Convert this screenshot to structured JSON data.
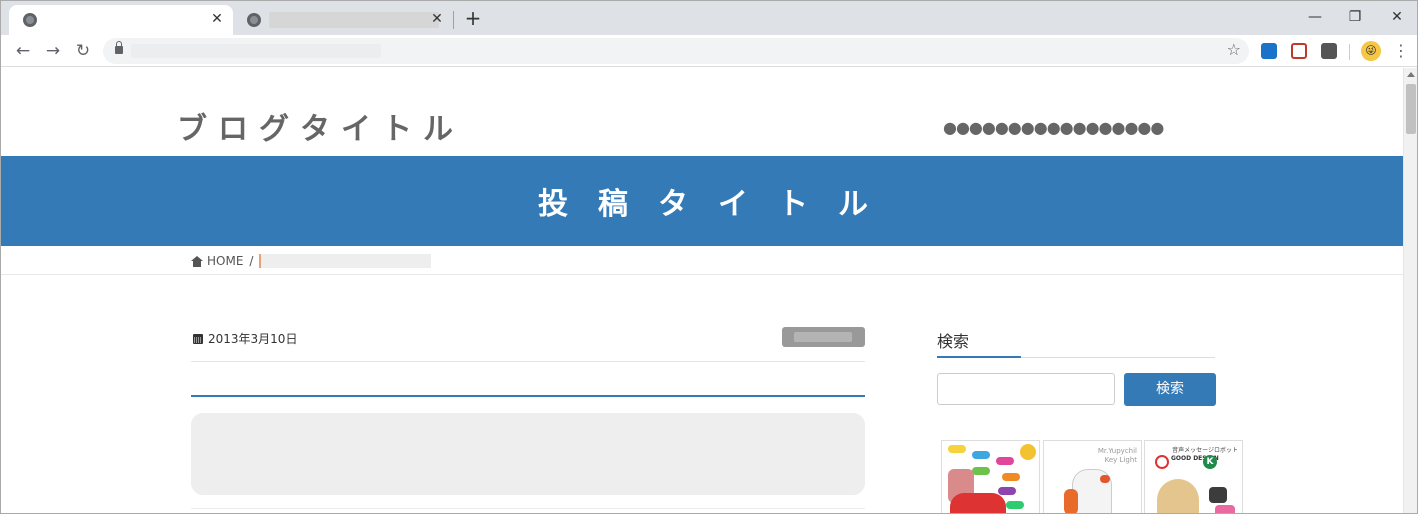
{
  "browser": {
    "close_glyph": "✕",
    "newtab_glyph": "+",
    "minimize_glyph": "—",
    "restore_glyph": "❐",
    "window_close_glyph": "✕",
    "back_glyph": "←",
    "forward_glyph": "→",
    "reload_glyph": "↻",
    "star_glyph": "☆",
    "menu_glyph": "⋮",
    "avatar_glyph": "😜"
  },
  "page": {
    "blog_title": "ブログタイトル",
    "header_dots": "●●●●●●●●●●●●●●●●●",
    "post_title": "投稿タイトル",
    "breadcrumb": {
      "home": "HOME",
      "separator": "/"
    },
    "post_date": "2013年3月10日",
    "sidebar": {
      "search_title": "検索",
      "search_button": "検索",
      "search_value": ""
    },
    "banners": {
      "robot_name": "Mr.Yupychil",
      "robot_sub": "Key Light",
      "message_robot": "音声メッセージロボット",
      "good_design": "GOOD DESIGN",
      "k_mark": "K"
    }
  },
  "colors": {
    "accent": "#337ab7",
    "tabstrip": "#dee1e6"
  }
}
